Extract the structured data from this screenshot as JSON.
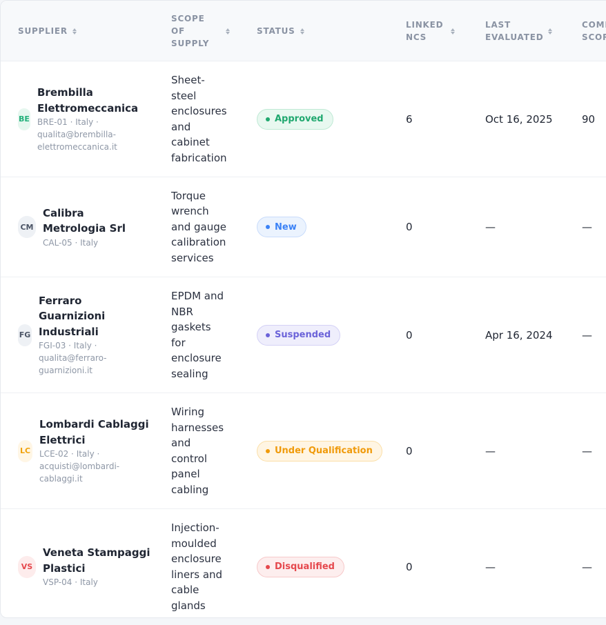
{
  "columns": {
    "supplier": "SUPPLIER",
    "scope_lines": [
      "SCOPE",
      "OF",
      "SUPPLY"
    ],
    "status": "STATUS",
    "linked_lines": [
      "LINKED",
      "NCS"
    ],
    "evaluated_lines": [
      "LAST",
      "EVALUATED"
    ],
    "score_lines": [
      "COMPOSITE",
      "SCORE"
    ]
  },
  "rows": [
    {
      "initials": "BE",
      "avatar_bg": "#e6f7ef",
      "avatar_fg": "#22b07a",
      "name_lines": [
        "Brembilla",
        "Elettromeccanica"
      ],
      "meta_lines": [
        "BRE-01 · Italy ·",
        "qualita@brembilla-",
        "elettromeccanica.it"
      ],
      "scope_lines": [
        "Sheet-",
        "steel",
        "enclosures",
        "and",
        "cabinet",
        "fabrication"
      ],
      "status": "Approved",
      "status_color": "#20a86f",
      "status_bg": "#e8f8f0",
      "status_border": "#bfe9d4",
      "linked_ncs": "6",
      "last_evaluated": "Oct 16, 2025",
      "score": "90"
    },
    {
      "initials": "CM",
      "avatar_bg": "#eef1f5",
      "avatar_fg": "#4c5566",
      "name_lines": [
        "Calibra",
        "Metrologia Srl"
      ],
      "meta_lines": [
        "CAL-05 · Italy"
      ],
      "scope_lines": [
        "Torque",
        "wrench",
        "and gauge",
        "calibration",
        "services"
      ],
      "status": "New",
      "status_color": "#3b82f6",
      "status_bg": "#ebf3fe",
      "status_border": "#c9dcfb",
      "linked_ncs": "0",
      "last_evaluated": "—",
      "score": "—"
    },
    {
      "initials": "FG",
      "avatar_bg": "#eef1f5",
      "avatar_fg": "#4c5566",
      "name_lines": [
        "Ferraro",
        "Guarnizioni",
        "Industriali"
      ],
      "meta_lines": [
        "FGI-03 · Italy ·",
        "qualita@ferraro-",
        "guarnizioni.it"
      ],
      "scope_lines": [
        "EPDM and",
        "NBR",
        "gaskets",
        "for",
        "enclosure",
        "sealing"
      ],
      "status": "Suspended",
      "status_color": "#6b63d9",
      "status_bg": "#efeefc",
      "status_border": "#d4d1f6",
      "linked_ncs": "0",
      "last_evaluated": "Apr 16, 2024",
      "score": "—"
    },
    {
      "initials": "LC",
      "avatar_bg": "#fff6e5",
      "avatar_fg": "#f0a20b",
      "name_lines": [
        "Lombardi Cablaggi",
        "Elettrici"
      ],
      "meta_lines": [
        "LCE-02 · Italy ·",
        "acquisti@lombardi-",
        "cablaggi.it"
      ],
      "scope_lines": [
        "Wiring",
        "harnesses",
        "and",
        "control",
        "panel",
        "cabling"
      ],
      "status": "Under Qualification",
      "status_color": "#f09a0a",
      "status_bg": "#fff5e3",
      "status_border": "#fbdfa8",
      "linked_ncs": "0",
      "last_evaluated": "—",
      "score": "—"
    },
    {
      "initials": "VS",
      "avatar_bg": "#fdecec",
      "avatar_fg": "#e5484d",
      "name_lines": [
        "Veneta Stampaggi",
        "Plastici"
      ],
      "meta_lines": [
        "VSP-04 · Italy"
      ],
      "scope_lines": [
        "Injection-",
        "moulded",
        "enclosure",
        "liners and",
        "cable",
        "glands"
      ],
      "status": "Disqualified",
      "status_color": "#e5484d",
      "status_bg": "#fdeeee",
      "status_border": "#f7c9ca",
      "linked_ncs": "0",
      "last_evaluated": "—",
      "score": "—"
    }
  ]
}
